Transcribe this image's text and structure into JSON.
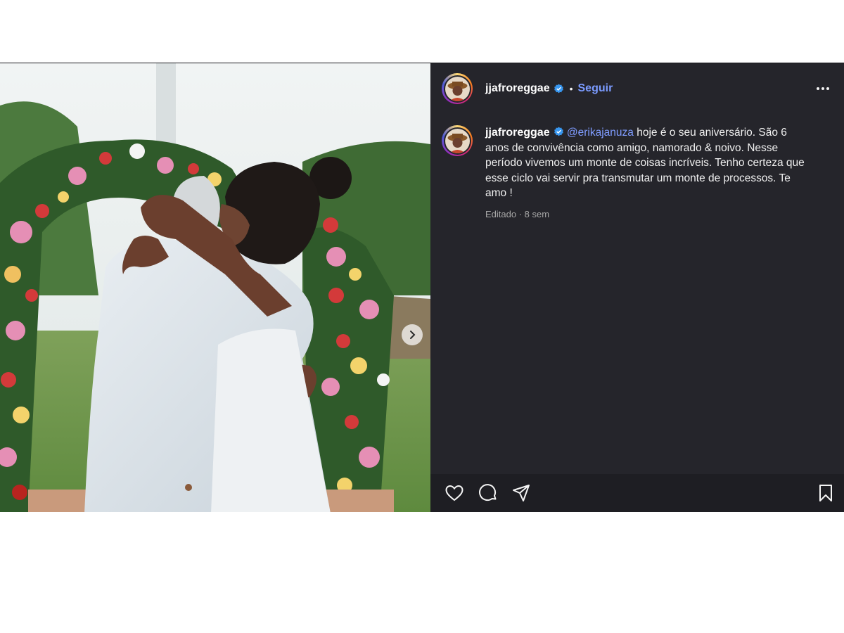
{
  "post": {
    "username": "jjafroreggae",
    "follow_label": "Seguir",
    "separator": "•",
    "caption": {
      "username": "jjafroreggae",
      "mention": "@erikajanuza",
      "text": " hoje é o seu aniversário. São 6 anos de convivência como amigo, namorado & noivo. Nesse período vivemos um monte de coisas incríveis. Tenho certeza que esse ciclo vai servir pra transmutar um monte de processos. Te amo !",
      "meta": "Editado · 8 sem"
    }
  },
  "icons": {
    "verified": "verified-badge-icon",
    "more": "more-options-icon",
    "like": "heart-icon",
    "comment": "comment-icon",
    "share": "send-icon",
    "save": "bookmark-icon",
    "next": "chevron-right-icon"
  },
  "colors": {
    "panel_bg": "#25252b",
    "follow": "#7b9bff",
    "mention": "#7f9cff",
    "verified": "#3897f0"
  }
}
